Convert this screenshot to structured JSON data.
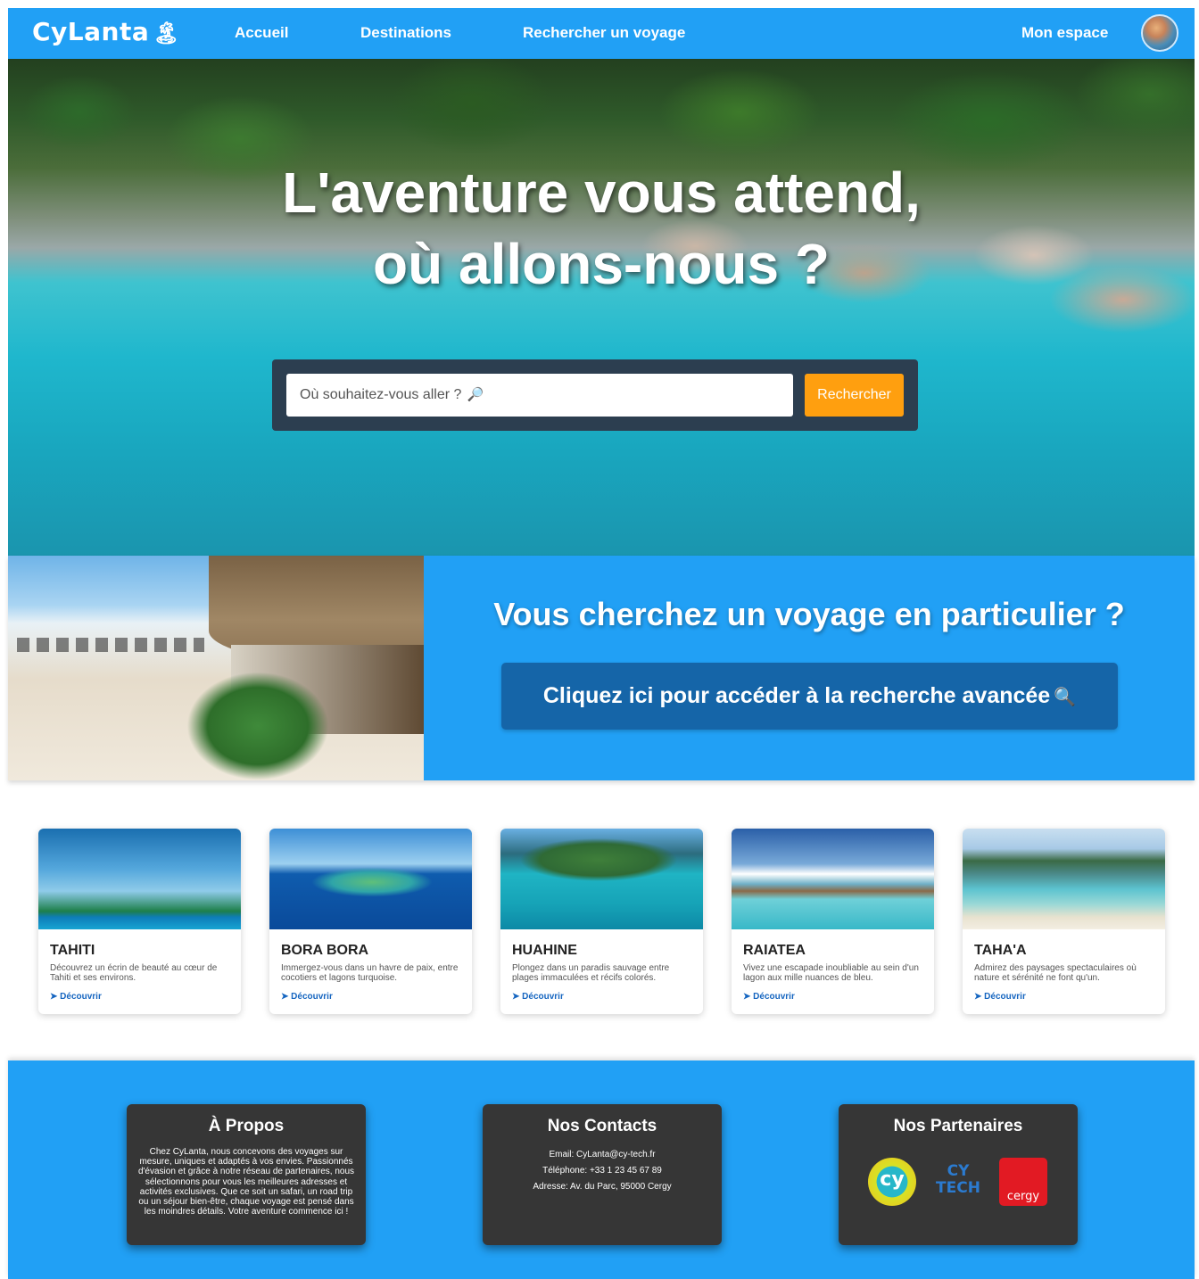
{
  "header": {
    "brand": "CyLanta",
    "brand_icon": "palm-tree-icon",
    "nav": [
      "Accueil",
      "Destinations",
      "Rechercher un voyage"
    ],
    "account": "Mon espace"
  },
  "hero": {
    "title_line1": "L'aventure vous attend,",
    "title_line2": "où allons-nous ?",
    "search_placeholder": "Où souhaitez-vous aller ?",
    "search_button": "Rechercher"
  },
  "promo": {
    "title": "Vous cherchez un voyage en particulier ?",
    "button": "Cliquez ici pour accéder à la recherche avancée"
  },
  "destinations": [
    {
      "name": "TAHITI",
      "desc": "Découvrez un écrin de beauté au cœur de Tahiti et ses environs.",
      "link": "Découvrir"
    },
    {
      "name": "BORA BORA",
      "desc": "Immergez-vous dans un havre de paix, entre cocotiers et lagons turquoise.",
      "link": "Découvrir"
    },
    {
      "name": "HUAHINE",
      "desc": "Plongez dans un paradis sauvage entre plages immaculées et récifs colorés.",
      "link": "Découvrir"
    },
    {
      "name": "RAIATEA",
      "desc": "Vivez une escapade inoubliable au sein d'un lagon aux mille nuances de bleu.",
      "link": "Découvrir"
    },
    {
      "name": "TAHA'A",
      "desc": "Admirez des paysages spectaculaires où nature et sérénité ne font qu'un.",
      "link": "Découvrir"
    }
  ],
  "footer": {
    "about_title": "À Propos",
    "about_text": "Chez CyLanta, nous concevons des voyages sur mesure, uniques et adaptés à vos envies. Passionnés d'évasion et grâce à notre réseau de partenaires, nous sélectionnons pour vous les meilleures adresses et activités exclusives. Que ce soit un safari, un road trip ou un séjour bien-être, chaque voyage est pensé dans les moindres détails. Votre aventure commence ici !",
    "contact_title": "Nos Contacts",
    "email": "Email: CyLanta@cy-tech.fr",
    "phone": "Téléphone: +33 1 23 45 67 89",
    "address": "Adresse: Av. du Parc, 95000 Cergy",
    "partners_title": "Nos Partenaires",
    "partners": [
      "cy",
      "CY TECH",
      "cergy"
    ]
  },
  "colors": {
    "primary": "#21a0f5",
    "dark": "#2c3e50",
    "accent": "#ff9f0f",
    "button_dark": "#1565a8",
    "footer_box": "#363636"
  }
}
